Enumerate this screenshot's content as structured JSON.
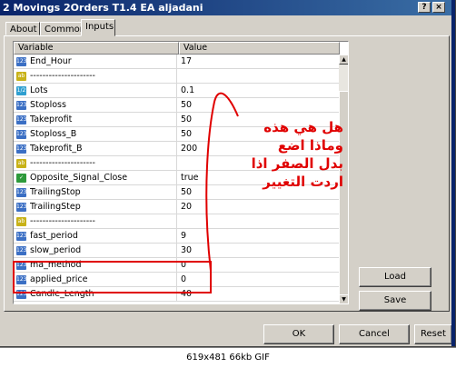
{
  "window": {
    "title": "2 Movings 2Orders T1.4 EA aljadani",
    "help_button": "?",
    "close_button": "×"
  },
  "tabs": [
    {
      "label": "About"
    },
    {
      "label": "Common"
    },
    {
      "label": "Inputs"
    }
  ],
  "table": {
    "col_variable": "Variable",
    "col_value": "Value",
    "rows": [
      {
        "type": "int",
        "icon": "123",
        "name": "End_Hour",
        "value": "17"
      },
      {
        "type": "str",
        "icon": "ab",
        "name": "---------------------",
        "value": ""
      },
      {
        "type": "dbl",
        "icon": "1/2",
        "name": "Lots",
        "value": "0.1"
      },
      {
        "type": "int",
        "icon": "123",
        "name": "Stoploss",
        "value": "50"
      },
      {
        "type": "int",
        "icon": "123",
        "name": "Takeprofit",
        "value": "50"
      },
      {
        "type": "int",
        "icon": "123",
        "name": "Stoploss_B",
        "value": "50"
      },
      {
        "type": "int",
        "icon": "123",
        "name": "Takeprofit_B",
        "value": "200"
      },
      {
        "type": "str",
        "icon": "ab",
        "name": "---------------------",
        "value": ""
      },
      {
        "type": "bool",
        "icon": "✓",
        "name": "Opposite_Signal_Close",
        "value": "true"
      },
      {
        "type": "int",
        "icon": "123",
        "name": "TrailingStop",
        "value": "50"
      },
      {
        "type": "int",
        "icon": "123",
        "name": "TrailingStep",
        "value": "20"
      },
      {
        "type": "str",
        "icon": "ab",
        "name": "---------------------",
        "value": ""
      },
      {
        "type": "int",
        "icon": "123",
        "name": "fast_period",
        "value": "9"
      },
      {
        "type": "int",
        "icon": "123",
        "name": "slow_period",
        "value": "30"
      },
      {
        "type": "int",
        "icon": "123",
        "name": "ma_method",
        "value": "0"
      },
      {
        "type": "int",
        "icon": "123",
        "name": "applied_price",
        "value": "0"
      },
      {
        "type": "int",
        "icon": "123",
        "name": "Candle_Length",
        "value": "40"
      }
    ]
  },
  "buttons": {
    "load": "Load",
    "save": "Save",
    "ok": "OK",
    "cancel": "Cancel",
    "reset": "Reset"
  },
  "annotation": {
    "lines": [
      "هل هي هذه",
      "وماذا اضع",
      "بدل الصفر اذا",
      "اردت التغيير"
    ],
    "color": "#e00000"
  },
  "caption": "619x481  66kb  GIF"
}
